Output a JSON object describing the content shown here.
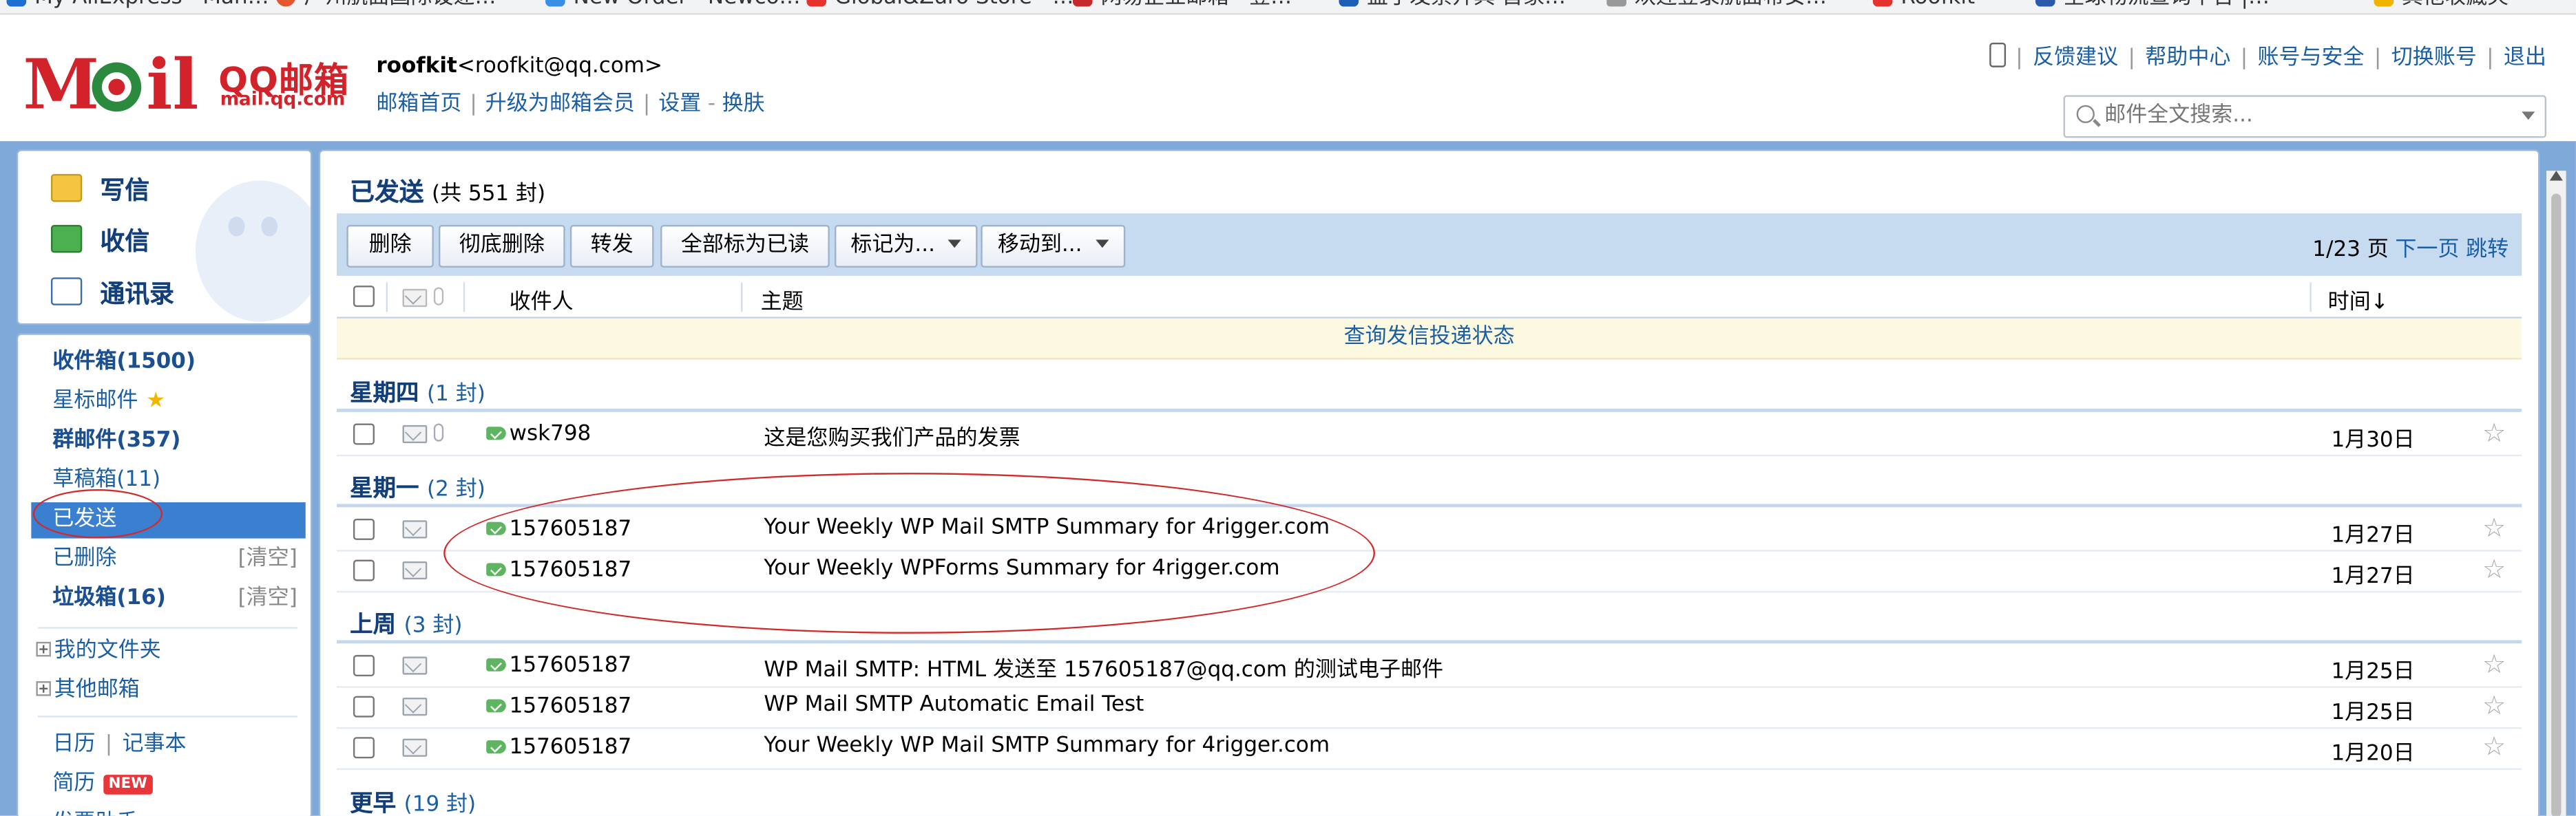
{
  "bookmarks": [
    "My AliExpress · Man…",
    "广州航面国际设递…",
    "New Order · Newco…",
    "Global&Zuro Store · …",
    "网易企业邮箱 · 登…",
    "益于发票开具·首家…",
    "欢迎登录航面希安…",
    "Roofkit",
    "全球物流查询平台 |…",
    "其他收藏夹"
  ],
  "header": {
    "logo_text": "QQ邮箱",
    "logo_sub": "mail.qq.com",
    "user_name": "roofkit",
    "user_email": "<roofkit@qq.com>",
    "user_links": [
      "邮箱首页",
      "升级为邮箱会员",
      "设置",
      "换肤"
    ],
    "top_links": [
      "反馈建议",
      "帮助中心",
      "账号与安全",
      "切换账号",
      "退出"
    ],
    "search_placeholder": "邮件全文搜索..."
  },
  "actions": [
    "写信",
    "收信",
    "通讯录"
  ],
  "sidebar": {
    "items": [
      {
        "label": "收件箱(1500)"
      },
      {
        "label": "星标邮件"
      },
      {
        "label": "群邮件(357)"
      },
      {
        "label": "草稿箱(11)"
      },
      {
        "label": "已发送"
      },
      {
        "label": "已删除",
        "action": "[清空]"
      },
      {
        "label": "垃圾箱(16)",
        "action": "[清空]"
      },
      {
        "label": "我的文件夹"
      },
      {
        "label": "其他邮箱"
      },
      {
        "label": "日历"
      },
      {
        "label": "记事本"
      },
      {
        "label": "简历",
        "badge": "NEW"
      },
      {
        "label": "发票助手"
      }
    ]
  },
  "main": {
    "folder": "已发送",
    "count": "(共 551 封)",
    "toolbar": [
      "删除",
      "彻底删除",
      "转发",
      "全部标为已读",
      "标记为...",
      "移动到..."
    ],
    "pager": {
      "page": "1/23",
      "page_unit": "页",
      "next": "下一页",
      "jump": "跳转"
    },
    "columns": {
      "recipient": "收件人",
      "subject": "主题",
      "time": "时间↓"
    },
    "status_link": "查询发信投递状态",
    "groups": [
      {
        "name": "星期四",
        "count": "(1 封)",
        "rows": [
          {
            "to": "wsk798",
            "subject": "这是您购买我们产品的发票",
            "date": "1月30日"
          }
        ]
      },
      {
        "name": "星期一",
        "count": "(2 封)",
        "rows": [
          {
            "to": "157605187",
            "subject": "Your Weekly WP Mail SMTP Summary for 4rigger.com",
            "date": "1月27日"
          },
          {
            "to": "157605187",
            "subject": "Your Weekly WPForms Summary for 4rigger.com",
            "date": "1月27日"
          }
        ]
      },
      {
        "name": "上周",
        "count": "(3 封)",
        "rows": [
          {
            "to": "157605187",
            "subject": "WP Mail SMTP: HTML 发送至 157605187@qq.com 的测试电子邮件",
            "date": "1月25日"
          },
          {
            "to": "157605187",
            "subject": "WP Mail SMTP Automatic Email Test",
            "date": "1月25日"
          },
          {
            "to": "157605187",
            "subject": "Your Weekly WP Mail SMTP Summary for 4rigger.com",
            "date": "1月20日"
          }
        ]
      },
      {
        "name": "更早",
        "count": "(19 封)",
        "rows": []
      }
    ]
  },
  "colors": {
    "accent": "#3b7fd1",
    "frame": "#7fa9d8",
    "brand_red": "#d2232a",
    "annotation": "#d12a2a"
  }
}
